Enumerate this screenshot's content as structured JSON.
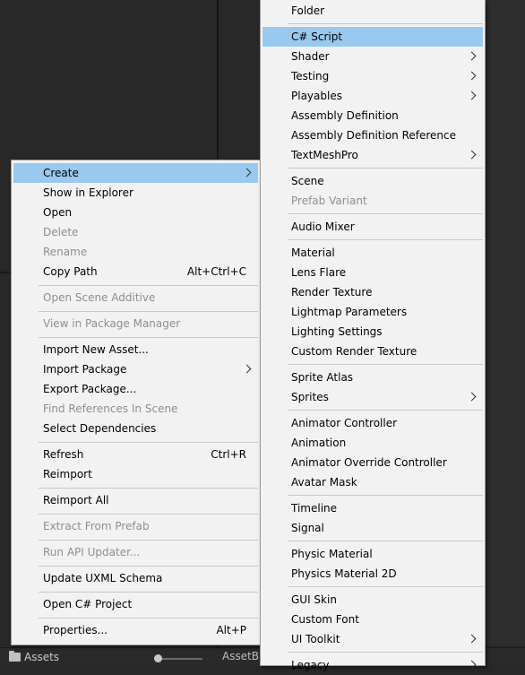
{
  "context_menu": {
    "items": [
      {
        "label": "Create",
        "arrow": true,
        "highlight": true
      },
      {
        "label": "Show in Explorer"
      },
      {
        "label": "Open"
      },
      {
        "label": "Delete",
        "disabled": true
      },
      {
        "label": "Rename",
        "disabled": true
      },
      {
        "label": "Copy Path",
        "shortcut": "Alt+Ctrl+C"
      },
      {
        "label": "Open Scene Additive",
        "disabled": true
      },
      {
        "label": "View in Package Manager",
        "disabled": true
      },
      {
        "label": "Import New Asset..."
      },
      {
        "label": "Import Package",
        "arrow": true
      },
      {
        "label": "Export Package..."
      },
      {
        "label": "Find References In Scene",
        "disabled": true
      },
      {
        "label": "Select Dependencies"
      },
      {
        "label": "Refresh",
        "shortcut": "Ctrl+R"
      },
      {
        "label": "Reimport"
      },
      {
        "label": "Reimport All"
      },
      {
        "label": "Extract From Prefab",
        "disabled": true
      },
      {
        "label": "Run API Updater...",
        "disabled": true
      },
      {
        "label": "Update UXML Schema"
      },
      {
        "label": "Open C# Project"
      },
      {
        "label": "Properties...",
        "shortcut": "Alt+P"
      }
    ]
  },
  "create_submenu": {
    "items": [
      {
        "label": "Folder"
      },
      {
        "label": "C# Script",
        "highlight": true
      },
      {
        "label": "Shader",
        "arrow": true
      },
      {
        "label": "Testing",
        "arrow": true
      },
      {
        "label": "Playables",
        "arrow": true
      },
      {
        "label": "Assembly Definition"
      },
      {
        "label": "Assembly Definition Reference"
      },
      {
        "label": "TextMeshPro",
        "arrow": true
      },
      {
        "label": "Scene"
      },
      {
        "label": "Prefab Variant",
        "disabled": true
      },
      {
        "label": "Audio Mixer"
      },
      {
        "label": "Material"
      },
      {
        "label": "Lens Flare"
      },
      {
        "label": "Render Texture"
      },
      {
        "label": "Lightmap Parameters"
      },
      {
        "label": "Lighting Settings"
      },
      {
        "label": "Custom Render Texture"
      },
      {
        "label": "Sprite Atlas"
      },
      {
        "label": "Sprites",
        "arrow": true
      },
      {
        "label": "Animator Controller"
      },
      {
        "label": "Animation"
      },
      {
        "label": "Animator Override Controller"
      },
      {
        "label": "Avatar Mask"
      },
      {
        "label": "Timeline"
      },
      {
        "label": "Signal"
      },
      {
        "label": "Physic Material"
      },
      {
        "label": "Physics Material 2D"
      },
      {
        "label": "GUI Skin"
      },
      {
        "label": "Custom Font"
      },
      {
        "label": "UI Toolkit",
        "arrow": true
      },
      {
        "label": "Legacy",
        "arrow": true
      }
    ]
  },
  "bottom_bar": {
    "assets_tab": "Assets",
    "asset_bundle_label": "AssetBu"
  },
  "colors": {
    "menu_bg": "#f2f2f2",
    "highlight": "#99c9ef",
    "disabled_text": "#8e8e8e",
    "editor_bg": "#282828"
  }
}
